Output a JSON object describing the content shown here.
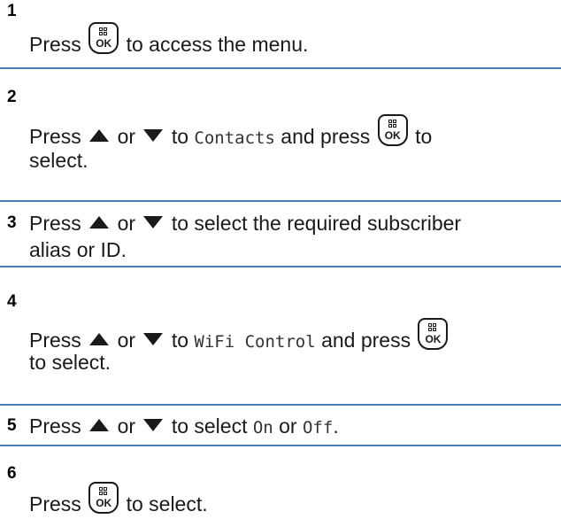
{
  "ok_key_label": "OK",
  "steps": [
    {
      "number": "1",
      "press": "Press",
      "after": "to access the menu."
    },
    {
      "number": "2",
      "press": "Press",
      "or": "or",
      "to": "to",
      "menu_item": "Contacts",
      "and_press": "and press",
      "to_select_tail": "to",
      "select_word": "select."
    },
    {
      "number": "3",
      "press": "Press",
      "or": "or",
      "after": "to select the required subscriber",
      "line2": "alias or ID."
    },
    {
      "number": "4",
      "press": "Press",
      "or": "or",
      "to": "to",
      "menu_item": "WiFi Control",
      "and_press": "and press",
      "line2": "to select."
    },
    {
      "number": "5",
      "press": "Press",
      "or": "or",
      "to_select": "to select",
      "option_on": "On",
      "or2": "or",
      "option_off": "Off",
      "period": "."
    },
    {
      "number": "6",
      "press": "Press",
      "after": "to select."
    }
  ],
  "colors": {
    "divider": "#4a7fb5",
    "text": "#1a1a1a"
  },
  "icons": [
    "ok-menu-key-icon",
    "up-arrow-icon",
    "down-arrow-icon"
  ]
}
